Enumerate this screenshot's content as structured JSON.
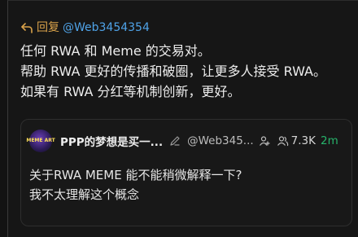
{
  "reply": {
    "label": "回复",
    "handle": "@Web3454354"
  },
  "post": {
    "lines": [
      "任何 RWA 和 Meme 的交易对。",
      "帮助 RWA 更好的传播和破圈，让更多人接受 RWA。",
      "如果有 RWA 分红等机制创新，更好。"
    ]
  },
  "quoted": {
    "avatar_text": "MEME ART",
    "name": "PPP的梦想是买一...",
    "handle": "@Web345...",
    "followers": "7.3K",
    "time": "2m",
    "lines": [
      "关于RWA MEME 能不能稍微解释一下?",
      "我不太理解这个概念"
    ]
  },
  "icons": {
    "reply": "reply-arrow-icon",
    "edit": "edit-icon",
    "follow": "add-user-icon",
    "fans": "users-icon"
  },
  "colors": {
    "reply_label": "#d9a24a",
    "handle": "#4fa3e8",
    "time": "#27b36b"
  }
}
